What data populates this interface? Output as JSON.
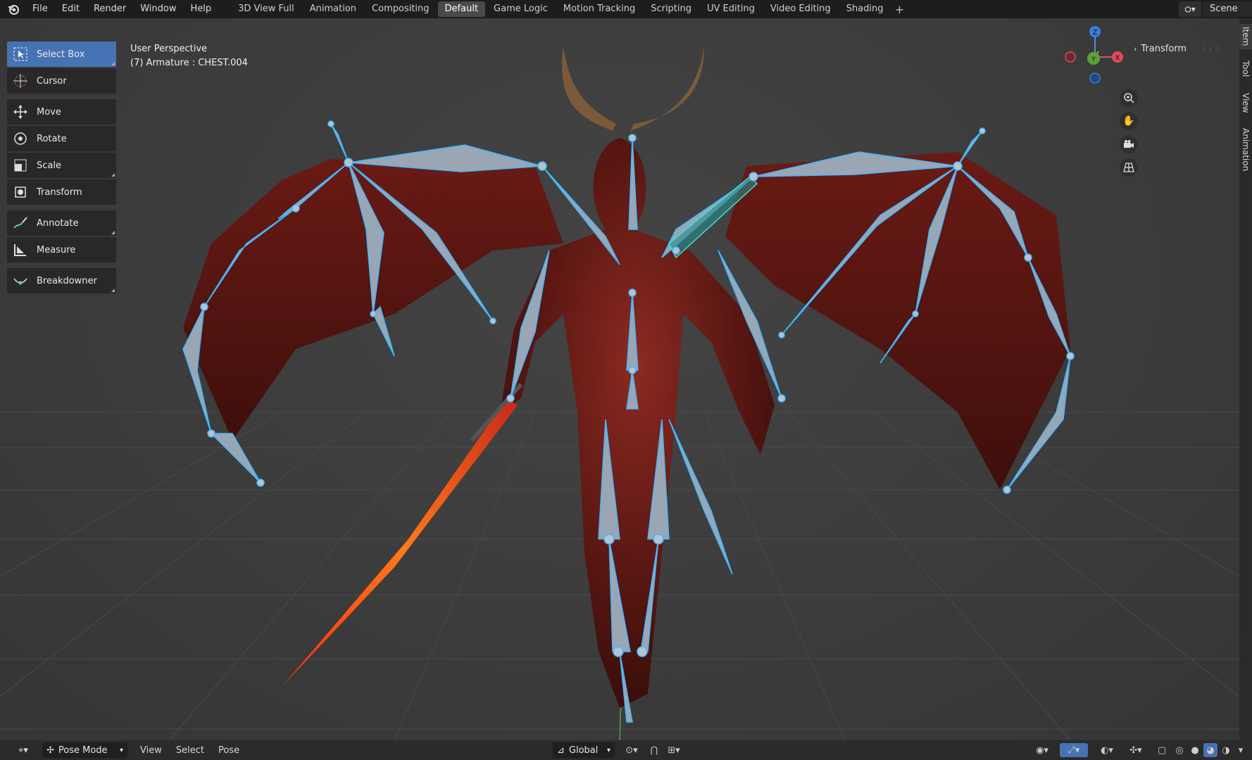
{
  "menu": [
    "File",
    "Edit",
    "Render",
    "Window",
    "Help"
  ],
  "workspaces": [
    "3D View Full",
    "Animation",
    "Compositing",
    "Default",
    "Game Logic",
    "Motion Tracking",
    "Scripting",
    "UV Editing",
    "Video Editing",
    "Shading"
  ],
  "active_workspace": "Default",
  "add_workspace": "+",
  "scene": {
    "name": "Scene"
  },
  "viewport": {
    "perspective": "User Perspective",
    "active": "(7) Armature : CHEST.004"
  },
  "tools": [
    {
      "name": "select-box",
      "label": "Select Box",
      "active": true
    },
    {
      "name": "cursor",
      "label": "Cursor"
    },
    {
      "name": "move",
      "label": "Move"
    },
    {
      "name": "rotate",
      "label": "Rotate"
    },
    {
      "name": "scale",
      "label": "Scale"
    },
    {
      "name": "transform",
      "label": "Transform"
    },
    {
      "name": "annotate",
      "label": "Annotate"
    },
    {
      "name": "measure",
      "label": "Measure"
    },
    {
      "name": "breakdowner",
      "label": "Breakdowner"
    }
  ],
  "gizmo": {
    "z": "Z",
    "y": "Y",
    "x": "X"
  },
  "sidebar": {
    "tabs": [
      "Item",
      "Tool",
      "View",
      "Animation"
    ],
    "panel": "Transform"
  },
  "header": {
    "mode": "Pose Mode",
    "menus": [
      "View",
      "Select",
      "Pose"
    ],
    "orientation": "Global"
  },
  "colors": {
    "accent": "#4772b3",
    "bone": "#9aa6b4",
    "bone_outline": "#3fb8ff"
  }
}
